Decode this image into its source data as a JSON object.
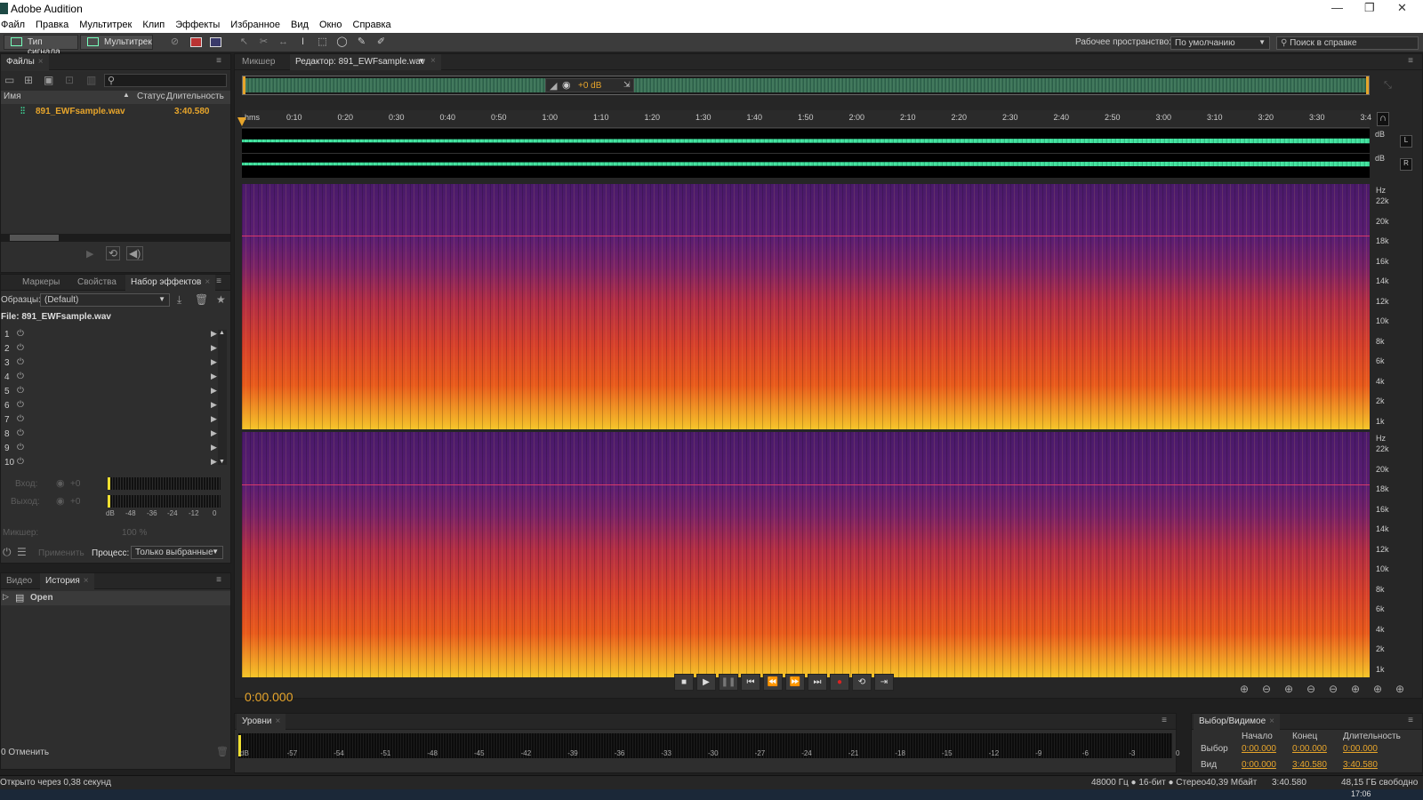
{
  "app": {
    "title": "Adobe Audition"
  },
  "menu": [
    "Файл",
    "Правка",
    "Мультитрек",
    "Клип",
    "Эффекты",
    "Избранное",
    "Вид",
    "Окно",
    "Справка"
  ],
  "toolbar": {
    "waveform_label": "Тип сигнала",
    "multitrack_label": "Мультитрек",
    "workspace_label": "Рабочее пространство:",
    "workspace_value": "По умолчанию",
    "help_search_placeholder": "Поиск в справке"
  },
  "files_panel": {
    "tab": "Файлы",
    "columns": {
      "name": "Имя",
      "status": "Статус",
      "duration": "Длительность"
    },
    "files": [
      {
        "name": "891_EWFsample.wav",
        "duration": "3:40.580"
      }
    ]
  },
  "effects_panel": {
    "tabs": [
      "Маркеры",
      "Свойства",
      "Набор эффектов"
    ],
    "presets_label": "Образцы:",
    "presets_value": "(Default)",
    "file_label": "File: 891_EWFsample.wav",
    "slots": [
      "1",
      "2",
      "3",
      "4",
      "5",
      "6",
      "7",
      "8",
      "9",
      "10"
    ],
    "input_label": "Вход:",
    "output_label": "Выход:",
    "gain_value": "+0",
    "meter_scale": [
      "dB",
      "-48",
      "-36",
      "-24",
      "-12",
      "0"
    ],
    "mixer_label": "Микшер:",
    "mixer_value": "100 %",
    "apply_label": "Применить",
    "process_label": "Процесс:",
    "process_value": "Только выбранные"
  },
  "history_panel": {
    "tabs": [
      "Видео",
      "История"
    ],
    "items": [
      "Open"
    ],
    "undo_label": "0 Отменить"
  },
  "editor": {
    "tabs": {
      "mixer": "Микшер",
      "editor": "Редактор: 891_EWFsample.wav"
    },
    "hud_gain": "+0 dB",
    "ruler_unit": "hms",
    "ruler": [
      "0:10",
      "0:20",
      "0:30",
      "0:40",
      "0:50",
      "1:00",
      "1:10",
      "1:20",
      "1:30",
      "1:40",
      "1:50",
      "2:00",
      "2:10",
      "2:20",
      "2:30",
      "2:40",
      "2:50",
      "3:00",
      "3:10",
      "3:20",
      "3:30",
      "3:4"
    ],
    "db_label": "dB",
    "channels": [
      "L",
      "R"
    ],
    "freq_unit": "Hz",
    "freq_ticks": [
      "22k",
      "20k",
      "18k",
      "16k",
      "14k",
      "12k",
      "10k",
      "8k",
      "6k",
      "4k",
      "2k",
      "1k"
    ],
    "current_time": "0:00.000"
  },
  "levels_panel": {
    "tab": "Уровни",
    "scale": [
      "dB",
      "-57",
      "-54",
      "-51",
      "-48",
      "-45",
      "-42",
      "-39",
      "-36",
      "-33",
      "-30",
      "-27",
      "-24",
      "-21",
      "-18",
      "-15",
      "-12",
      "-9",
      "-6",
      "-3",
      "0"
    ]
  },
  "selection_panel": {
    "tab": "Выбор/Видимое",
    "headers": {
      "start": "Начало",
      "end": "Конец",
      "duration": "Длительность"
    },
    "selection": {
      "label": "Выбор",
      "start": "0:00.000",
      "end": "0:00.000",
      "duration": "0:00.000"
    },
    "view": {
      "label": "Вид",
      "start": "0:00.000",
      "end": "3:40.580",
      "duration": "3:40.580"
    }
  },
  "status": {
    "left": "Открыто через 0,38 секунд",
    "format": "48000 Гц ● 16-бит ● Стерео",
    "size": "40,39 Мбайт",
    "duration": "3:40.580",
    "free": "48,15 ГБ свободно"
  },
  "taskbar": {
    "clock": "17:06"
  },
  "colors": {
    "accent": "#e7a52b",
    "waveform": "#3fdc9a",
    "spec_hot": "#f5c52a",
    "spec_mid": "#d6402b",
    "spec_low": "#4a1a6a"
  }
}
